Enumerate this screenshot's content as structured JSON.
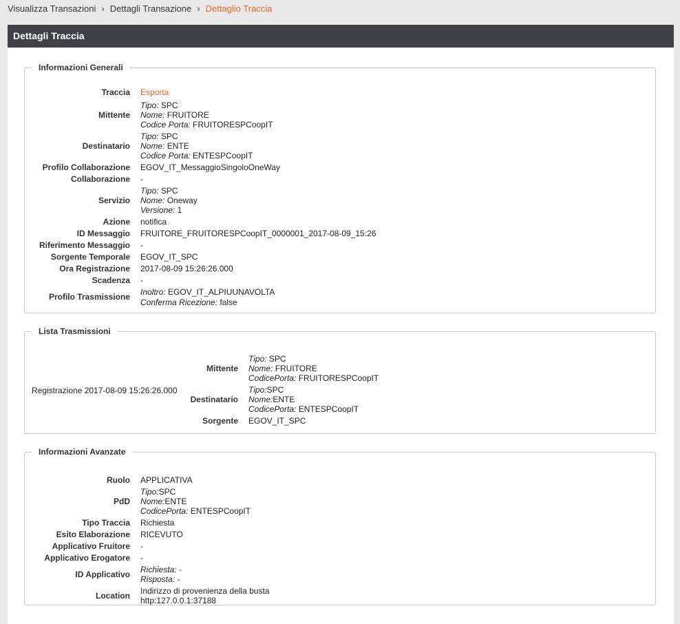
{
  "breadcrumb": {
    "items": [
      "Visualizza Transazioni",
      "Dettagli Transazione"
    ],
    "active": "Dettaglio Traccia"
  },
  "panel": {
    "title": "Dettagli Traccia"
  },
  "generali": {
    "legend": "Informazioni Generali",
    "traccia": {
      "label": "Traccia",
      "link": "Esporta"
    },
    "mittente": {
      "label": "Mittente",
      "tipo_k": "Tipo:",
      "tipo_v": "SPC",
      "nome_k": "Nome:",
      "nome_v": "FRUITORE",
      "porta_k": "Codice Porta:",
      "porta_v": "FRUITORESPCoopIT"
    },
    "destinatario": {
      "label": "Destinatario",
      "tipo_k": "Tipo:",
      "tipo_v": "SPC",
      "nome_k": "Nome:",
      "nome_v": "ENTE",
      "porta_k": "Codice Porta:",
      "porta_v": "ENTESPCoopIT"
    },
    "profilo_collab": {
      "label": "Profilo Collaborazione",
      "value": "EGOV_IT_MessaggioSingoloOneWay"
    },
    "collaborazione": {
      "label": "Collaborazione",
      "value": "-"
    },
    "servizio": {
      "label": "Servizio",
      "tipo_k": "Tipo:",
      "tipo_v": "SPC",
      "nome_k": "Nome:",
      "nome_v": "Oneway",
      "ver_k": "Versione:",
      "ver_v": "1"
    },
    "azione": {
      "label": "Azione",
      "value": "notifica"
    },
    "id_messaggio": {
      "label": "ID Messaggio",
      "value": "FRUITORE_FRUITORESPCoopIT_0000001_2017-08-09_15:26"
    },
    "rif_messaggio": {
      "label": "Riferimento Messaggio",
      "value": "-"
    },
    "sorgente": {
      "label": "Sorgente Temporale",
      "value": "EGOV_IT_SPC"
    },
    "ora": {
      "label": "Ora Registrazione",
      "value": "2017-08-09 15:26:26.000"
    },
    "scadenza": {
      "label": "Scadenza",
      "value": "-"
    },
    "profilo_tras": {
      "label": "Profilo Trasmissione",
      "inoltro_k": "Inoltro:",
      "inoltro_v": "EGOV_IT_ALPIUUNAVOLTA",
      "conferma_k": "Conferma Ricezione:",
      "conferma_v": "false"
    }
  },
  "lista": {
    "legend": "Lista Trasmissioni",
    "registrazione": "Registrazione 2017-08-09 15:26:26.000",
    "mittente": {
      "label": "Mittente",
      "tipo_k": "Tipo:",
      "tipo_v": "SPC",
      "nome_k": "Nome:",
      "nome_v": "FRUITORE",
      "porta_k": "CodicePorta:",
      "porta_v": "FRUITORESPCoopIT"
    },
    "destinatario": {
      "label": "Destinatario",
      "tipo_k": "Tipo:",
      "tipo_v": "SPC",
      "nome_k": "Nome:",
      "nome_v": "ENTE",
      "porta_k": "CodicePorta:",
      "porta_v": "ENTESPCoopIT"
    },
    "sorgente": {
      "label": "Sorgente",
      "value": "EGOV_IT_SPC"
    }
  },
  "avanzate": {
    "legend": "Informazioni Avanzate",
    "ruolo": {
      "label": "Ruolo",
      "value": "APPLICATIVA"
    },
    "pdd": {
      "label": "PdD",
      "tipo_k": "Tipo:",
      "tipo_v": "SPC",
      "nome_k": "Nome:",
      "nome_v": "ENTE",
      "porta_k": "CodicePorta:",
      "porta_v": "ENTESPCoopIT"
    },
    "tipo_traccia": {
      "label": "Tipo Traccia",
      "value": "Richiesta"
    },
    "esito": {
      "label": "Esito Elaborazione",
      "value": "RICEVUTO"
    },
    "app_fruitore": {
      "label": "Applicativo Fruitore",
      "value": "-"
    },
    "app_erogatore": {
      "label": "Applicativo Erogatore",
      "value": "-"
    },
    "id_applicativo": {
      "label": "ID Applicativo",
      "rich_k": "Richiesta:",
      "rich_v": "-",
      "risp_k": "Risposta:",
      "risp_v": "-"
    },
    "location": {
      "label": "Location",
      "line1": "Indirizzo di provenienza della busta",
      "line2": "http:127.0.0.1:37188"
    }
  }
}
